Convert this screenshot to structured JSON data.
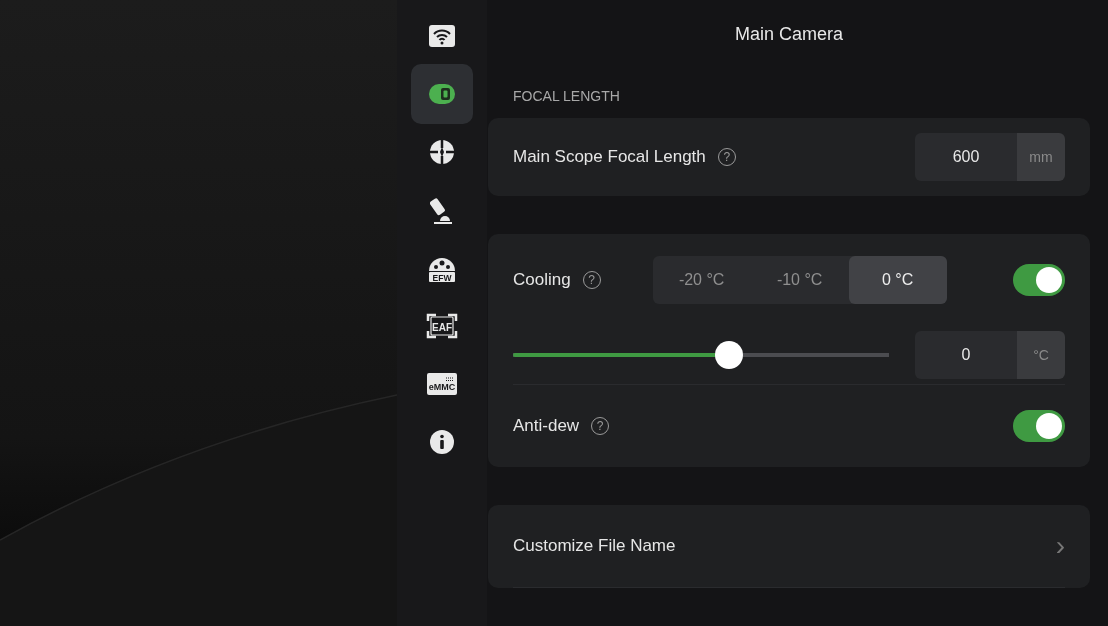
{
  "sidebar": {
    "items": [
      {
        "kind": "wifi",
        "selected": false
      },
      {
        "kind": "camera",
        "selected": true
      },
      {
        "kind": "guide",
        "selected": false
      },
      {
        "kind": "telescope",
        "selected": false
      },
      {
        "kind": "efw",
        "label": "EFW",
        "selected": false
      },
      {
        "kind": "eaf",
        "label": "EAF",
        "selected": false
      },
      {
        "kind": "emmc",
        "label": "eMMC",
        "selected": false
      },
      {
        "kind": "info",
        "selected": false
      }
    ]
  },
  "title": "Main Camera",
  "section_label": "FOCAL LENGTH",
  "focal_length": {
    "label": "Main Scope Focal Length",
    "help": "?",
    "value": "600",
    "unit": "mm"
  },
  "cooling": {
    "label": "Cooling",
    "help": "?",
    "options": [
      {
        "label": "-20 °C",
        "selected": false
      },
      {
        "label": "-10 °C",
        "selected": false
      },
      {
        "label": "0 °C",
        "selected": true
      }
    ],
    "on": true,
    "level": 0.574,
    "value": "0",
    "unit": "°C"
  },
  "anti_dew": {
    "label": "Anti-dew",
    "help": "?",
    "on": true
  },
  "links": [
    {
      "label": "Customize File Name",
      "chevron": "›"
    }
  ]
}
